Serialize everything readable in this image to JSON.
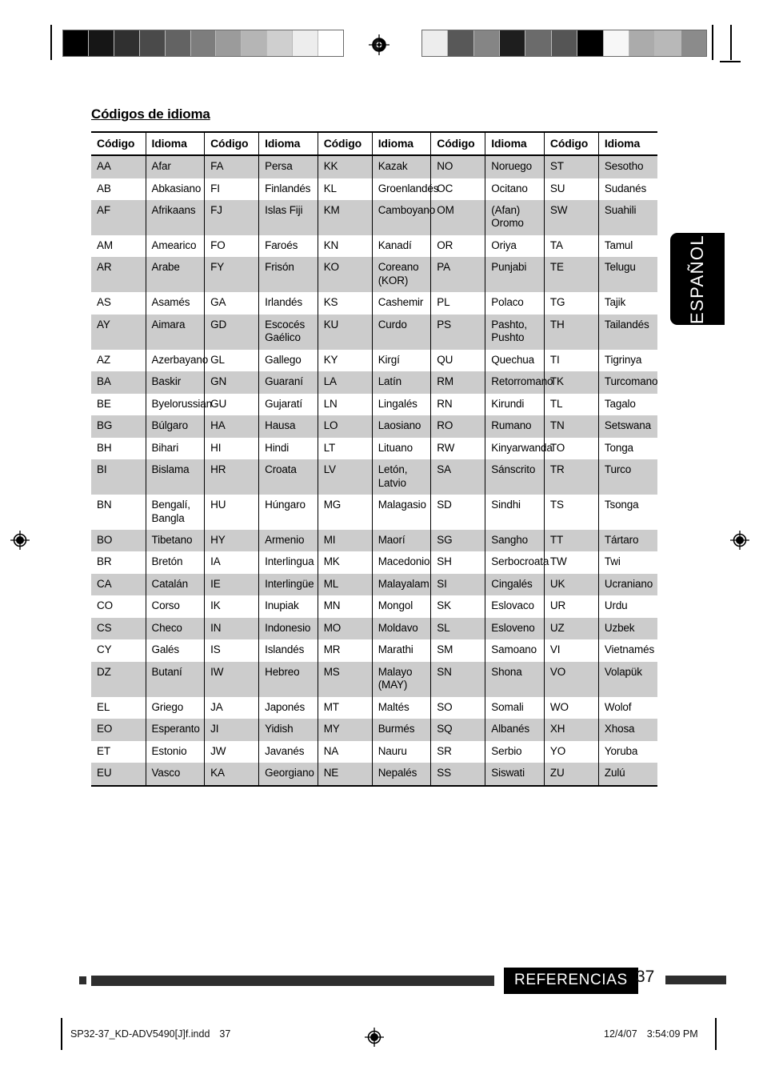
{
  "page": {
    "title": "Códigos de idioma",
    "side_tab_label": "ESPAÑOL",
    "footer_section": "REFERENCIAS",
    "footer_page_number": "37"
  },
  "slug": {
    "file_name": "SP32-37_KD-ADV5490[J]f.indd",
    "file_page": "37",
    "date": "12/4/07",
    "time": "3:54:09 PM"
  },
  "table": {
    "headers": [
      "Código",
      "Idioma",
      "Código",
      "Idioma",
      "Código",
      "Idioma",
      "Código",
      "Idioma",
      "Código",
      "Idioma"
    ],
    "rows": [
      [
        "AA",
        "Afar",
        "FA",
        "Persa",
        "KK",
        "Kazak",
        "NO",
        "Noruego",
        "ST",
        "Sesotho"
      ],
      [
        "AB",
        "Abkasiano",
        "FI",
        "Finlandés",
        "KL",
        "Groenlandés",
        "OC",
        "Ocitano",
        "SU",
        "Sudanés"
      ],
      [
        "AF",
        "Afrikaans",
        "FJ",
        "Islas Fiji",
        "KM",
        "Camboyano",
        "OM",
        "(Afan) Oromo",
        "SW",
        "Suahili"
      ],
      [
        "AM",
        "Amearico",
        "FO",
        "Faroés",
        "KN",
        "Kanadí",
        "OR",
        "Oriya",
        "TA",
        "Tamul"
      ],
      [
        "AR",
        "Arabe",
        "FY",
        "Frisón",
        "KO",
        "Coreano\n(KOR)",
        "PA",
        "Punjabi",
        "TE",
        "Telugu"
      ],
      [
        "AS",
        "Asamés",
        "GA",
        "Irlandés",
        "KS",
        "Cashemir",
        "PL",
        "Polaco",
        "TG",
        "Tajik"
      ],
      [
        "AY",
        "Aimara",
        "GD",
        "Escocés\nGaélico",
        "KU",
        "Curdo",
        "PS",
        "Pashto,\nPushto",
        "TH",
        "Tailandés"
      ],
      [
        "AZ",
        "Azerbayano",
        "GL",
        "Gallego",
        "KY",
        "Kirgí",
        "QU",
        "Quechua",
        "TI",
        "Tigrinya"
      ],
      [
        "BA",
        "Baskir",
        "GN",
        "Guaraní",
        "LA",
        "Latín",
        "RM",
        "Retorromano",
        "TK",
        "Turcomano"
      ],
      [
        "BE",
        "Byelorussian",
        "GU",
        "Gujaratí",
        "LN",
        "Lingalés",
        "RN",
        "Kirundi",
        "TL",
        "Tagalo"
      ],
      [
        "BG",
        "Búlgaro",
        "HA",
        "Hausa",
        "LO",
        "Laosiano",
        "RO",
        "Rumano",
        "TN",
        "Setswana"
      ],
      [
        "BH",
        "Bihari",
        "HI",
        "Hindi",
        "LT",
        "Lituano",
        "RW",
        "Kinyarwanda",
        "TO",
        "Tonga"
      ],
      [
        "BI",
        "Bislama",
        "HR",
        "Croata",
        "LV",
        "Letón,\nLatvio",
        "SA",
        "Sánscrito",
        "TR",
        "Turco"
      ],
      [
        "BN",
        "Bengalí,\nBangla",
        "HU",
        "Húngaro",
        "MG",
        "Malagasio",
        "SD",
        "Sindhi",
        "TS",
        "Tsonga"
      ],
      [
        "BO",
        "Tibetano",
        "HY",
        "Armenio",
        "MI",
        "Maorí",
        "SG",
        "Sangho",
        "TT",
        "Tártaro"
      ],
      [
        "BR",
        "Bretón",
        "IA",
        "Interlingua",
        "MK",
        "Macedonio",
        "SH",
        "Serbocroata",
        "TW",
        "Twi"
      ],
      [
        "CA",
        "Catalán",
        "IE",
        "Interlingüe",
        "ML",
        "Malayalam",
        "SI",
        "Cingalés",
        "UK",
        "Ucraniano"
      ],
      [
        "CO",
        "Corso",
        "IK",
        "Inupiak",
        "MN",
        "Mongol",
        "SK",
        "Eslovaco",
        "UR",
        "Urdu"
      ],
      [
        "CS",
        "Checo",
        "IN",
        "Indonesio",
        "MO",
        "Moldavo",
        "SL",
        "Esloveno",
        "UZ",
        "Uzbek"
      ],
      [
        "CY",
        "Galés",
        "IS",
        "Islandés",
        "MR",
        "Marathi",
        "SM",
        "Samoano",
        "VI",
        "Vietnamés"
      ],
      [
        "DZ",
        "Butaní",
        "IW",
        "Hebreo",
        "MS",
        "Malayo\n(MAY)",
        "SN",
        "Shona",
        "VO",
        "Volapük"
      ],
      [
        "EL",
        "Griego",
        "JA",
        "Japonés",
        "MT",
        "Maltés",
        "SO",
        "Somali",
        "WO",
        "Wolof"
      ],
      [
        "EO",
        "Esperanto",
        "JI",
        "Yidish",
        "MY",
        "Burmés",
        "SQ",
        "Albanés",
        "XH",
        "Xhosa"
      ],
      [
        "ET",
        "Estonio",
        "JW",
        "Javanés",
        "NA",
        "Nauru",
        "SR",
        "Serbio",
        "YO",
        "Yoruba"
      ],
      [
        "EU",
        "Vasco",
        "KA",
        "Georgiano",
        "NE",
        "Nepalés",
        "SS",
        "Siswati",
        "ZU",
        "Zulú"
      ]
    ]
  },
  "print_marks": {
    "colorbar_left": [
      "#000000",
      "#161616",
      "#303030",
      "#4a4a4a",
      "#636363",
      "#7d7d7d",
      "#9b9b9b",
      "#b5b5b5",
      "#cfcfcf",
      "#ededed",
      "#ffffff"
    ],
    "colorbar_right": [
      "#ededed",
      "#585858",
      "#858585",
      "#1e1e1e",
      "#6b6b6b",
      "#555555",
      "#000000",
      "#f7f7f7",
      "#ababab",
      "#b8b8b8",
      "#8b8b8b"
    ],
    "registration_icon": "registration-target-icon"
  },
  "colors": {
    "shade_row": "#cccccc",
    "rule": "#000000",
    "footer_bar": "#2e2e2e",
    "tab_bg": "#000000"
  }
}
